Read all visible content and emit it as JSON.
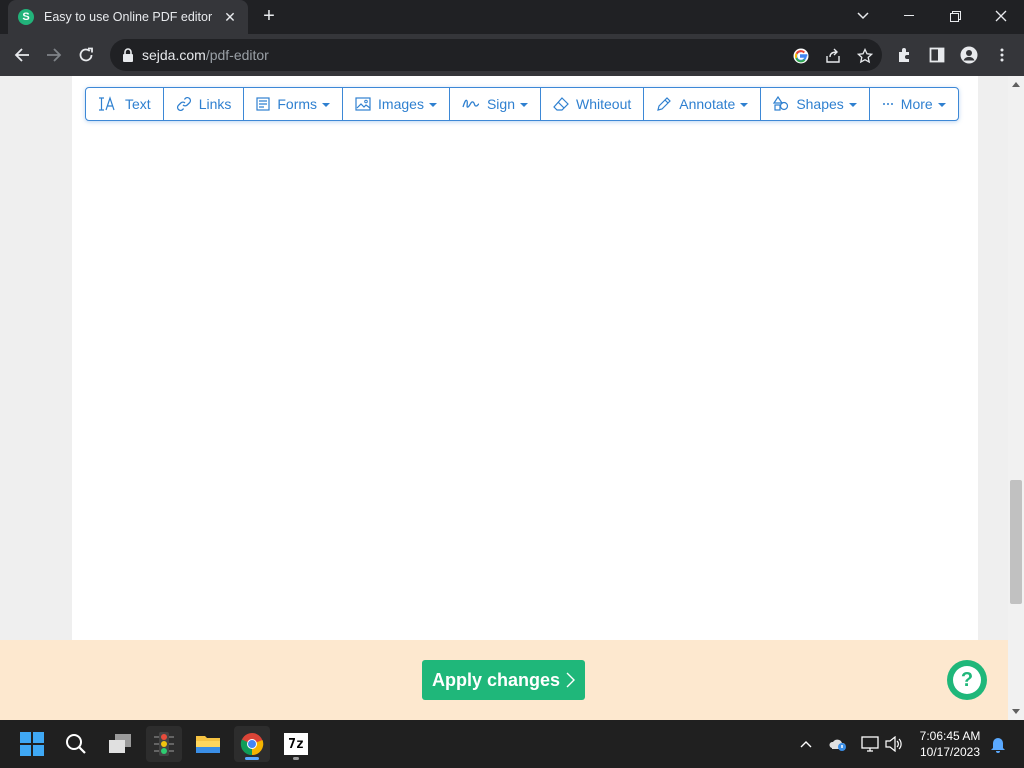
{
  "browser": {
    "tab": {
      "favicon_letter": "S",
      "title": "Easy to use Online PDF editor",
      "close_glyph": "✕"
    },
    "new_tab_glyph": "+",
    "window_controls": [
      "chevron-down-icon",
      "minimize-icon",
      "restore-icon",
      "close-icon"
    ],
    "address": {
      "host": "sejda.com",
      "path": "/pdf-editor"
    },
    "toolbar_icons": [
      "google-icon",
      "share-icon",
      "star-icon",
      "extensions-icon",
      "sidepanel-icon",
      "profile-icon",
      "menu-icon"
    ]
  },
  "editor": {
    "toolbar": [
      {
        "label": "Text",
        "icon": "text-icon",
        "dropdown": false
      },
      {
        "label": "Links",
        "icon": "link-icon",
        "dropdown": false
      },
      {
        "label": "Forms",
        "icon": "forms-icon",
        "dropdown": true
      },
      {
        "label": "Images",
        "icon": "image-icon",
        "dropdown": true
      },
      {
        "label": "Sign",
        "icon": "signature-icon",
        "dropdown": true
      },
      {
        "label": "Whiteout",
        "icon": "eraser-icon",
        "dropdown": false
      },
      {
        "label": "Annotate",
        "icon": "pen-icon",
        "dropdown": true
      },
      {
        "label": "Shapes",
        "icon": "shapes-icon",
        "dropdown": true
      },
      {
        "label": "More",
        "icon": "ellipsis-icon",
        "dropdown": true
      }
    ],
    "apply_label": "Apply changes",
    "apply_chevron": "〉",
    "help_glyph": "?"
  },
  "colors": {
    "accent_blue": "#2f80d0",
    "apply_green": "#1fb77a",
    "bottom_bar": "#fde8cf"
  },
  "taskbar": {
    "apps": [
      "windows-start-icon",
      "search-icon",
      "task-view-icon",
      "traffic-light-app-icon",
      "file-explorer-icon",
      "chrome-icon",
      "7zip-icon"
    ],
    "seven_zip_label": "7z",
    "tray": [
      "chevron-up-icon",
      "onedrive-icon",
      "network-icon",
      "volume-icon",
      "notification-icon"
    ],
    "time": "7:06:45 AM",
    "date": "10/17/2023"
  }
}
